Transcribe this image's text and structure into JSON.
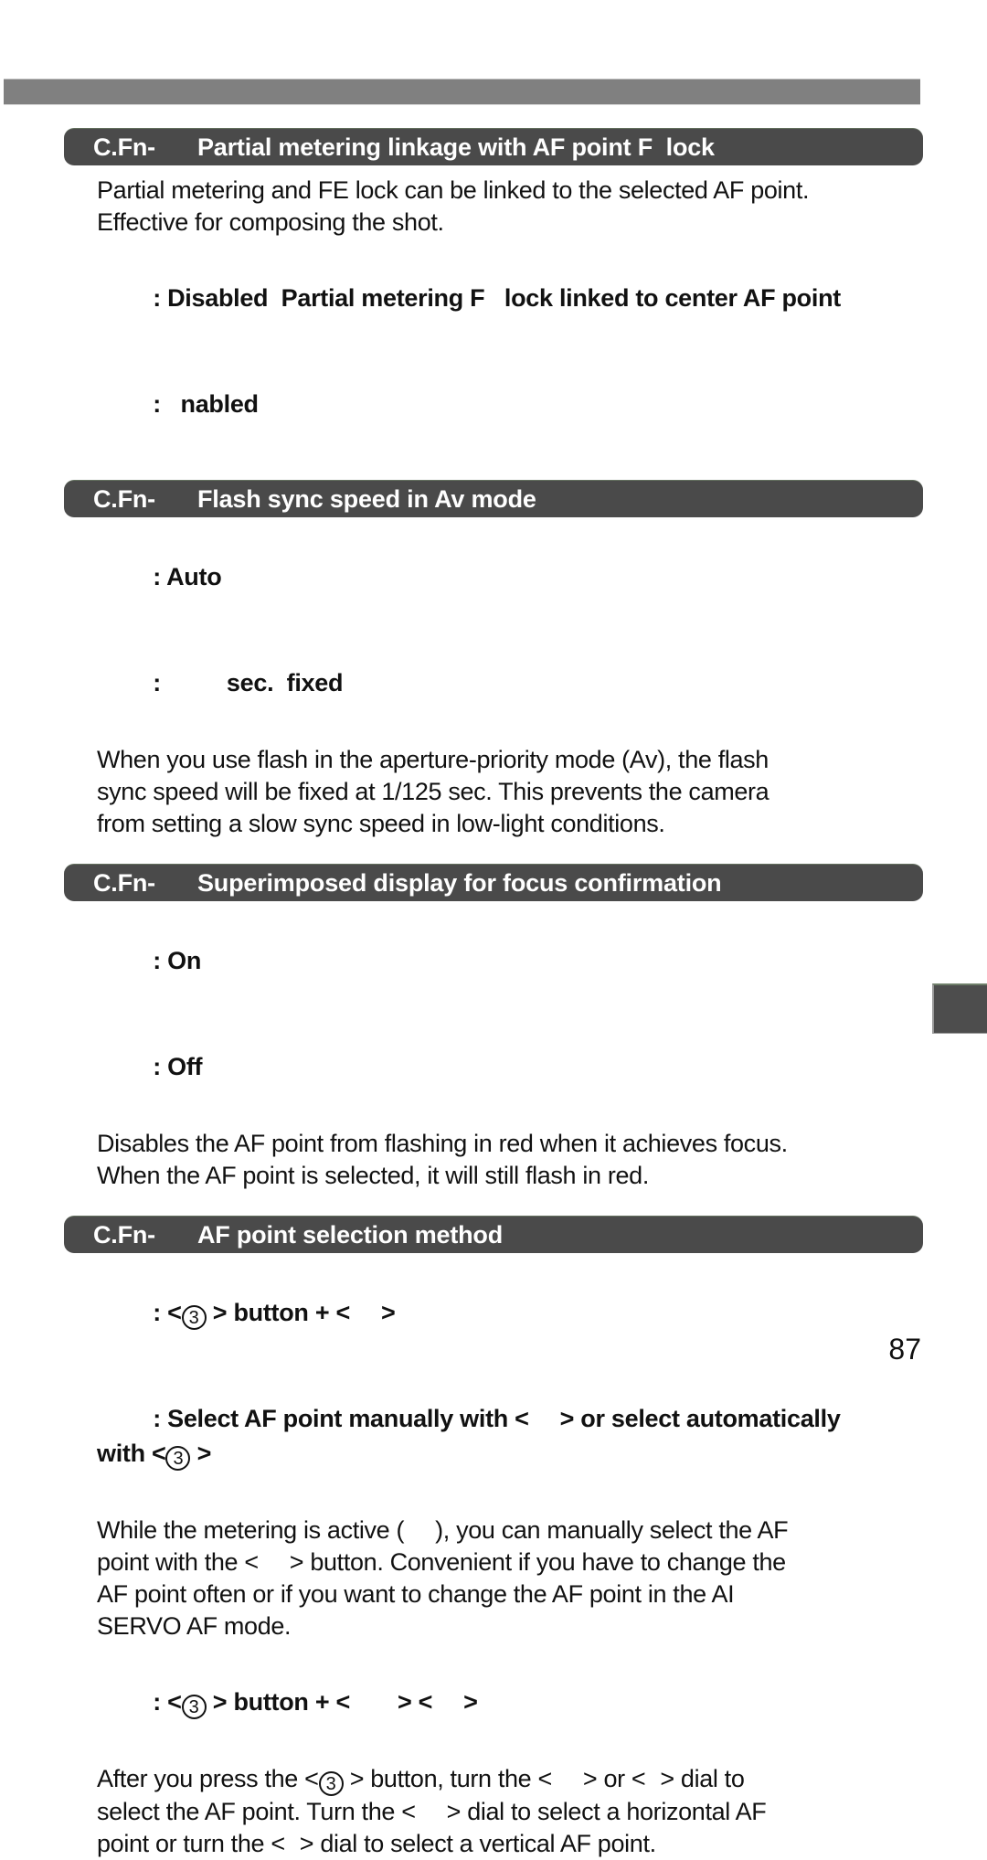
{
  "document": {
    "page_number": "87",
    "top_band_color": "#808080",
    "heading_bar_color": "#4a4a4a",
    "edge_tab_color": "#4d4d4d"
  },
  "sections": [
    {
      "prefix": "C.Fn-",
      "number": "",
      "title": "Partial metering linkage with AF point F  lock",
      "intro": "Partial metering and FE lock can be linked to the selected AF point.\nEffective for composing the shot.",
      "options": [
        {
          "num": "",
          "text": ": Disabled  Partial metering F   lock linked to center AF point"
        },
        {
          "num": "",
          "text": ":   nabled"
        }
      ]
    },
    {
      "prefix": "C.Fn-",
      "number": "",
      "title": "Flash sync speed in Av mode",
      "options": [
        {
          "num": "",
          "text": ": Auto"
        },
        {
          "num": "",
          "text": ":          sec.  fixed"
        }
      ],
      "body": "When you use flash in the aperture-priority mode (Av), the flash\nsync speed will be fixed at 1/125 sec. This prevents the camera\nfrom setting a slow sync speed in low-light conditions."
    },
    {
      "prefix": "C.Fn-",
      "number": "",
      "title": "Superimposed display for focus confirmation",
      "options": [
        {
          "num": "",
          "text": ": On"
        },
        {
          "num": "",
          "text": ": Off"
        }
      ],
      "body": "Disables the AF point from flashing in red when it achieves focus.\nWhen the AF point is selected, it will still flash in red."
    },
    {
      "prefix": "C.Fn-",
      "number": "",
      "title": "AF point selection method",
      "option_a_pre": ": <",
      "option_a_circled": "3",
      "option_a_post": " > button + <",
      "option_a_end": ">",
      "option_b_pre": ": Select AF point manually with <",
      "option_b_mid": "> or select automatically",
      "option_b_line2_pre": "with <",
      "option_b_circled": "3",
      "option_b_line2_post": " >",
      "body_a_1": "While the metering is active (",
      "body_a_2": "), you can manually select the AF",
      "body_a_3": "point with the <",
      "body_a_4": "> button. Convenient if you have to change the",
      "body_a_5": "AF point often or if you want to change the AF point in the AI",
      "body_a_6": "SERVO AF mode.",
      "option_c_pre": ": <",
      "option_c_circled": "3",
      "option_c_post": " > button + <",
      "option_c_mid": "> <",
      "option_c_end": ">",
      "body_b_1": "After you press the <",
      "body_b_circled": "3",
      "body_b_2": " > button, turn the <",
      "body_b_3": "> or <",
      "body_b_4": "> dial to",
      "body_b_5": "select the AF point. Turn the <",
      "body_b_6": "> dial to select a horizontal AF",
      "body_b_7": "point or turn the <",
      "body_b_8": "> dial to select a vertical AF point."
    }
  ]
}
